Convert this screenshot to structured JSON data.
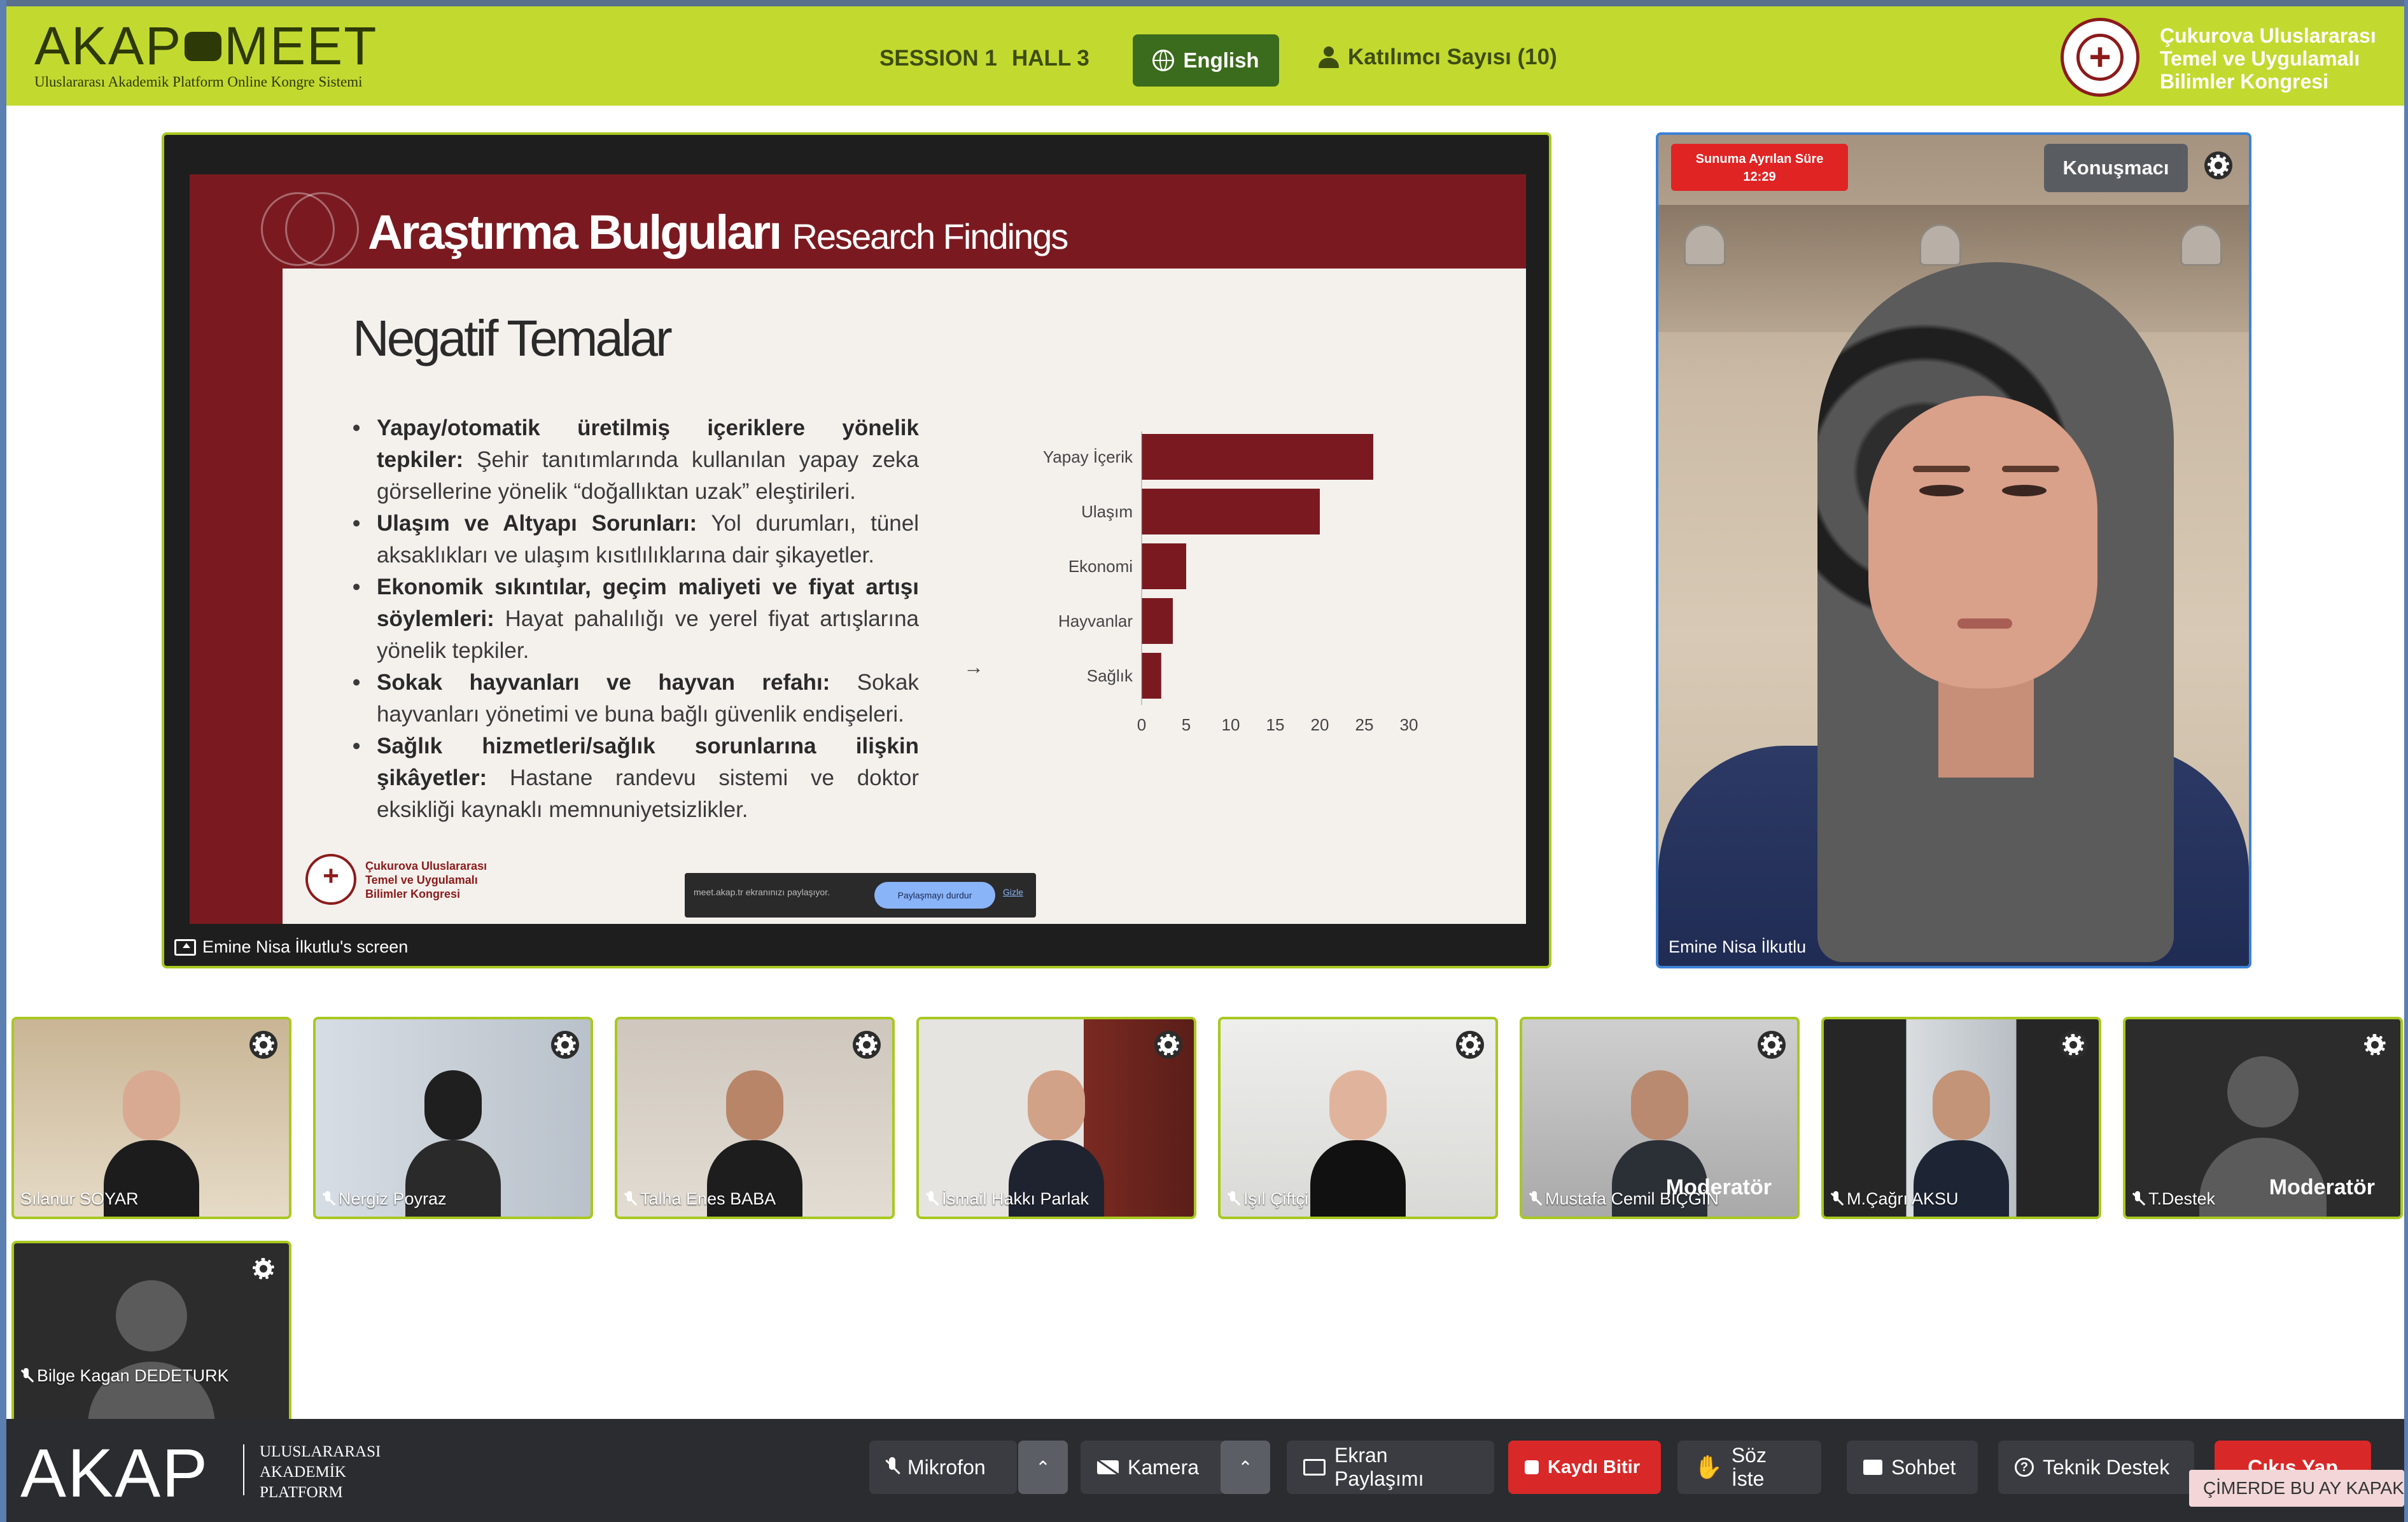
{
  "header": {
    "logo": "AKAP MEET",
    "logo_left": "AKAP",
    "logo_right": "MEET",
    "logo_subtitle": "Uluslararası Akademik Platform Online Kongre Sistemi",
    "session": "SESSION 1",
    "hall": "HALL 3",
    "language": "English",
    "participants": "Katılımcı Sayısı (10)",
    "congress_name": [
      "Çukurova Uluslararası",
      "Temel ve Uygulamalı",
      "Bilimler Kongresi"
    ]
  },
  "slide": {
    "title": "Araştırma Bulguları",
    "title_en": "Research Findings",
    "heading": "Negatif Temalar",
    "bullets": [
      {
        "bold": "Yapay/otomatik üretilmiş içeriklere yönelik tepkiler:",
        "text": " Şehir tanıtımlarında kullanılan yapay zeka görsellerine yönelik “doğallıktan uzak” eleştirileri."
      },
      {
        "bold": "Ulaşım ve Altyapı Sorunları:",
        "text": " Yol durumları, tünel aksaklıkları ve ulaşım kısıtlılıklarına dair şikayetler."
      },
      {
        "bold": "Ekonomik sıkıntılar, geçim maliyeti ve fiyat artışı söylemleri:",
        "text": " Hayat pahalılığı ve yerel fiyat artışlarına yönelik tepkiler."
      },
      {
        "bold": "Sokak hayvanları ve hayvan refahı:",
        "text": " Sokak hayvanları yönetimi ve buna bağlı güvenlik endişeleri."
      },
      {
        "bold": "Sağlık hizmetleri/sağlık sorunlarına ilişkin şikâyetler:",
        "text": " Hastane randevu sistemi ve doktor eksikliği kaynaklı memnuniyetsizlikler."
      }
    ],
    "footer_org": [
      "Çukurova Uluslararası",
      "Temel ve Uygulamalı",
      "Bilimler Kongresi"
    ],
    "share_notice": "meet.akap.tr ekranınızı paylaşıyor.",
    "share_stop": "Paylaşmayı durdur",
    "share_hide": "Gizle"
  },
  "chart_data": {
    "type": "bar",
    "orientation": "horizontal",
    "categories": [
      "Yapay İçerik",
      "Ulaşım",
      "Ekonomi",
      "Hayvanlar",
      "Sağlık"
    ],
    "values": [
      26,
      20,
      5,
      3.5,
      2.2
    ],
    "xticks": [
      0,
      5,
      10,
      15,
      20,
      25,
      30
    ],
    "xlim": [
      0,
      30
    ],
    "color": "#7a1a20",
    "grid": false
  },
  "screen_label": "Emine Nisa İlkutlu's screen",
  "speaker": {
    "name": "Emine Nisa İlkutlu",
    "timer_label": "Sunuma Ayrılan Süre",
    "timer_value": "12:29",
    "role": "Konuşmacı"
  },
  "thumbnails": [
    {
      "name": "Sılanur SOYAR"
    },
    {
      "name": "Nergiz Poyraz"
    },
    {
      "name": "Talha Enes BABA"
    },
    {
      "name": "İsmail Hakkı Parlak"
    },
    {
      "name": "Işıl Çiftçi"
    },
    {
      "name": "Mustafa Cemil BİÇGİN",
      "badge": "Moderatör"
    },
    {
      "name": "M.Çağrı AKSU"
    },
    {
      "name": "T.Destek",
      "badge": "Moderatör"
    },
    {
      "name": "Bilge Kagan DEDETURK"
    }
  ],
  "bottom_bar": {
    "logo": "AKAP",
    "logo_sub": [
      "ULUSLARARASI",
      "AKADEMİK",
      "PLATFORM"
    ],
    "mic": "Mikrofon",
    "camera": "Kamera",
    "screen_share": "Ekran Paylaşımı",
    "record": "Kaydı Bitir",
    "raise_hand": "Söz İste",
    "chat": "Sohbet",
    "support": "Teknik Destek",
    "exit": "Çıkış Yap",
    "marquee": "ÇİMERDE BU AY KAPAK-B"
  },
  "colors": {
    "header_bg": "#c2d930",
    "accent_green": "#3b6b1c",
    "slide_red": "#7a1a20",
    "record_red": "#d92828",
    "bottom_bg": "#2a2c30"
  }
}
